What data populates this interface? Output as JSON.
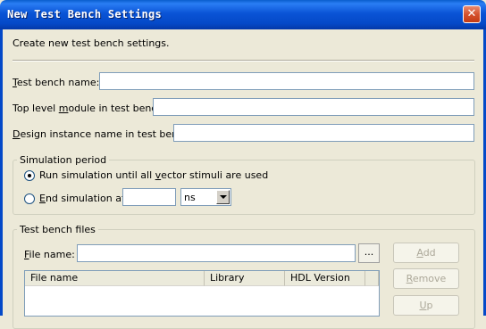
{
  "window": {
    "title": "New Test Bench Settings",
    "close_glyph": "✕"
  },
  "intro": "Create new test bench settings.",
  "fields": {
    "test_bench_name": {
      "label_pre": "",
      "label_key": "T",
      "label_post": "est bench name:",
      "value": ""
    },
    "top_level_module": {
      "label_pre": "Top level ",
      "label_key": "m",
      "label_post": "odule in test bench:",
      "value": ""
    },
    "design_instance": {
      "label_pre": "",
      "label_key": "D",
      "label_post": "esign instance name in test bench:",
      "value": ""
    }
  },
  "simulation": {
    "legend": "Simulation period",
    "run_until": {
      "pre": "Run simulation until all ",
      "key": "v",
      "post": "ector stimuli are used",
      "selected": true
    },
    "end_at": {
      "pre": "",
      "key": "E",
      "post": "nd simulation at:",
      "selected": false,
      "value": ""
    },
    "unit": "ns"
  },
  "files": {
    "legend": "Test bench files",
    "file_name_label_key": "F",
    "file_name_label_post": "ile name:",
    "file_name_value": "",
    "browse_label": "...",
    "columns": [
      "File name",
      "Library",
      "HDL Version"
    ],
    "buttons": {
      "add": {
        "key": "A",
        "post": "dd"
      },
      "remove": {
        "key": "R",
        "post": "emove"
      },
      "up": {
        "key": "U",
        "post": "p"
      }
    }
  }
}
